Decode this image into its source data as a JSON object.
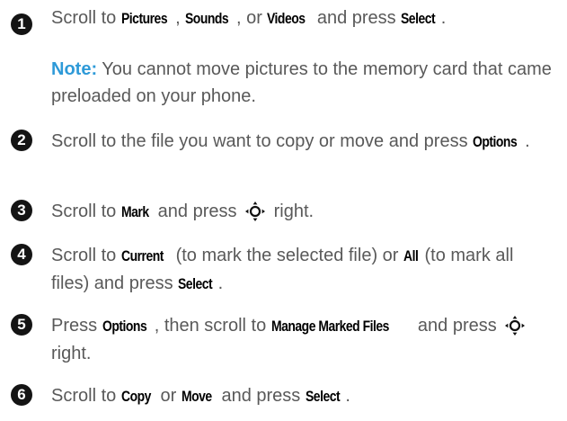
{
  "steps": [
    {
      "number": "1",
      "parts": [
        {
          "t": "Scroll to "
        },
        {
          "k": "Pictures"
        },
        {
          "t": ", "
        },
        {
          "k": "Sounds"
        },
        {
          "t": ", or "
        },
        {
          "k": "Videos"
        },
        {
          "t": " and press "
        },
        {
          "k": "Select"
        },
        {
          "t": "."
        }
      ]
    },
    {
      "number": "2",
      "parts": [
        {
          "t": "Scroll to the file you want to copy or move and press "
        },
        {
          "k": "Options"
        },
        {
          "t": "."
        }
      ]
    },
    {
      "number": "3",
      "parts": [
        {
          "t": "Scroll to "
        },
        {
          "k": "Mark"
        },
        {
          "t": " and press "
        },
        {
          "icon": "nav-key-icon"
        },
        {
          "t": " right."
        }
      ]
    },
    {
      "number": "4",
      "parts": [
        {
          "t": "Scroll to "
        },
        {
          "k": "Current"
        },
        {
          "t": " (to mark the selected file) or "
        },
        {
          "k": "All"
        },
        {
          "t": " (to mark all files) and press "
        },
        {
          "k": "Select"
        },
        {
          "t": "."
        }
      ]
    },
    {
      "number": "5",
      "parts": [
        {
          "t": "Press "
        },
        {
          "k": "Options"
        },
        {
          "t": ", then scroll to "
        },
        {
          "k": "Manage Marked Files"
        },
        {
          "t": " and press "
        },
        {
          "icon": "nav-key-icon"
        },
        {
          "t": " right."
        }
      ]
    },
    {
      "number": "6",
      "parts": [
        {
          "t": "Scroll to "
        },
        {
          "k": "Copy"
        },
        {
          "t": " or "
        },
        {
          "k": "Move"
        },
        {
          "t": " and press "
        },
        {
          "k": "Select"
        },
        {
          "t": "."
        }
      ]
    }
  ],
  "note": {
    "label": "Note:",
    "text": " You cannot move pictures to the memory card that came preloaded on your phone."
  },
  "colors": {
    "note_label": "#2e9ad8",
    "body_text": "#595959",
    "key_text": "#000000",
    "number_bg": "#141414"
  }
}
